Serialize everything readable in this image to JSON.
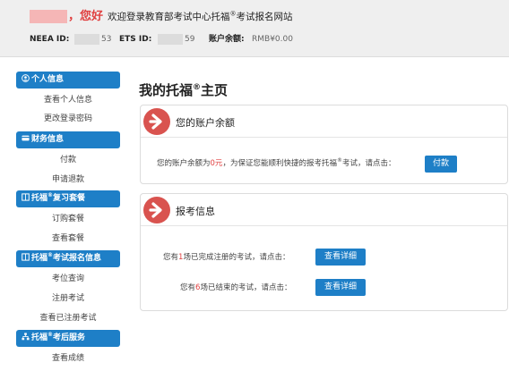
{
  "header": {
    "greeting": "，您好",
    "welcome_pre": "欢迎登录教育部考试中心托福",
    "welcome_reg": "®",
    "welcome_post": "考试报名网站",
    "neea_label": "NEEA ID:",
    "neea_tail": "53",
    "ets_label": "ETS ID:",
    "ets_tail": "59",
    "balance_label": "账户余额:",
    "balance_value": "RMB¥0.00"
  },
  "sidebar": {
    "sections": [
      {
        "icon": "user-circle-icon",
        "title": "个人信息",
        "links": [
          "查看个人信息",
          "更改登录密码"
        ]
      },
      {
        "icon": "credit-card-icon",
        "title": "财务信息",
        "links": [
          "付款",
          "申请退款"
        ]
      },
      {
        "icon": "book-icon",
        "title_pre": "托福",
        "title_reg": "®",
        "title_post": "复习套餐",
        "links": [
          "订购套餐",
          "查看套餐"
        ]
      },
      {
        "icon": "book-icon",
        "title_pre": "托福",
        "title_reg": "®",
        "title_post": "考试报名信息",
        "links": [
          "考位查询",
          "注册考试",
          "查看已注册考试"
        ]
      },
      {
        "icon": "sitemap-icon",
        "title_pre": "托福",
        "title_reg": "®",
        "title_post": "考后服务",
        "links": [
          "查看成绩"
        ]
      }
    ]
  },
  "main": {
    "title": "我的托福",
    "title_reg": "®",
    "title_post": "主页",
    "balance_panel": {
      "icon": "arrow-right-circle-icon",
      "title": "您的账户余额",
      "text_pre": "您的账户余额为",
      "amount": "0元",
      "text_mid": "，为保证您能顺利快捷的报考托福",
      "text_reg": "®",
      "text_post": "考试，请点击：",
      "button": "付款"
    },
    "exam_panel": {
      "icon": "arrow-right-circle-icon",
      "title": "报考信息",
      "row1_pre": "您有",
      "row1_count": "1",
      "row1_post": "场已完成注册的考试，请点击：",
      "row1_button": "查看详细",
      "row2_pre": "您有",
      "row2_count": "6",
      "row2_post": "场已结束的考试，请点击：",
      "row2_button": "查看详细"
    }
  },
  "colors": {
    "accent": "#1e7fc7",
    "alert": "#e04040",
    "badge": "#d9534f",
    "header_bg": "#efefef"
  }
}
